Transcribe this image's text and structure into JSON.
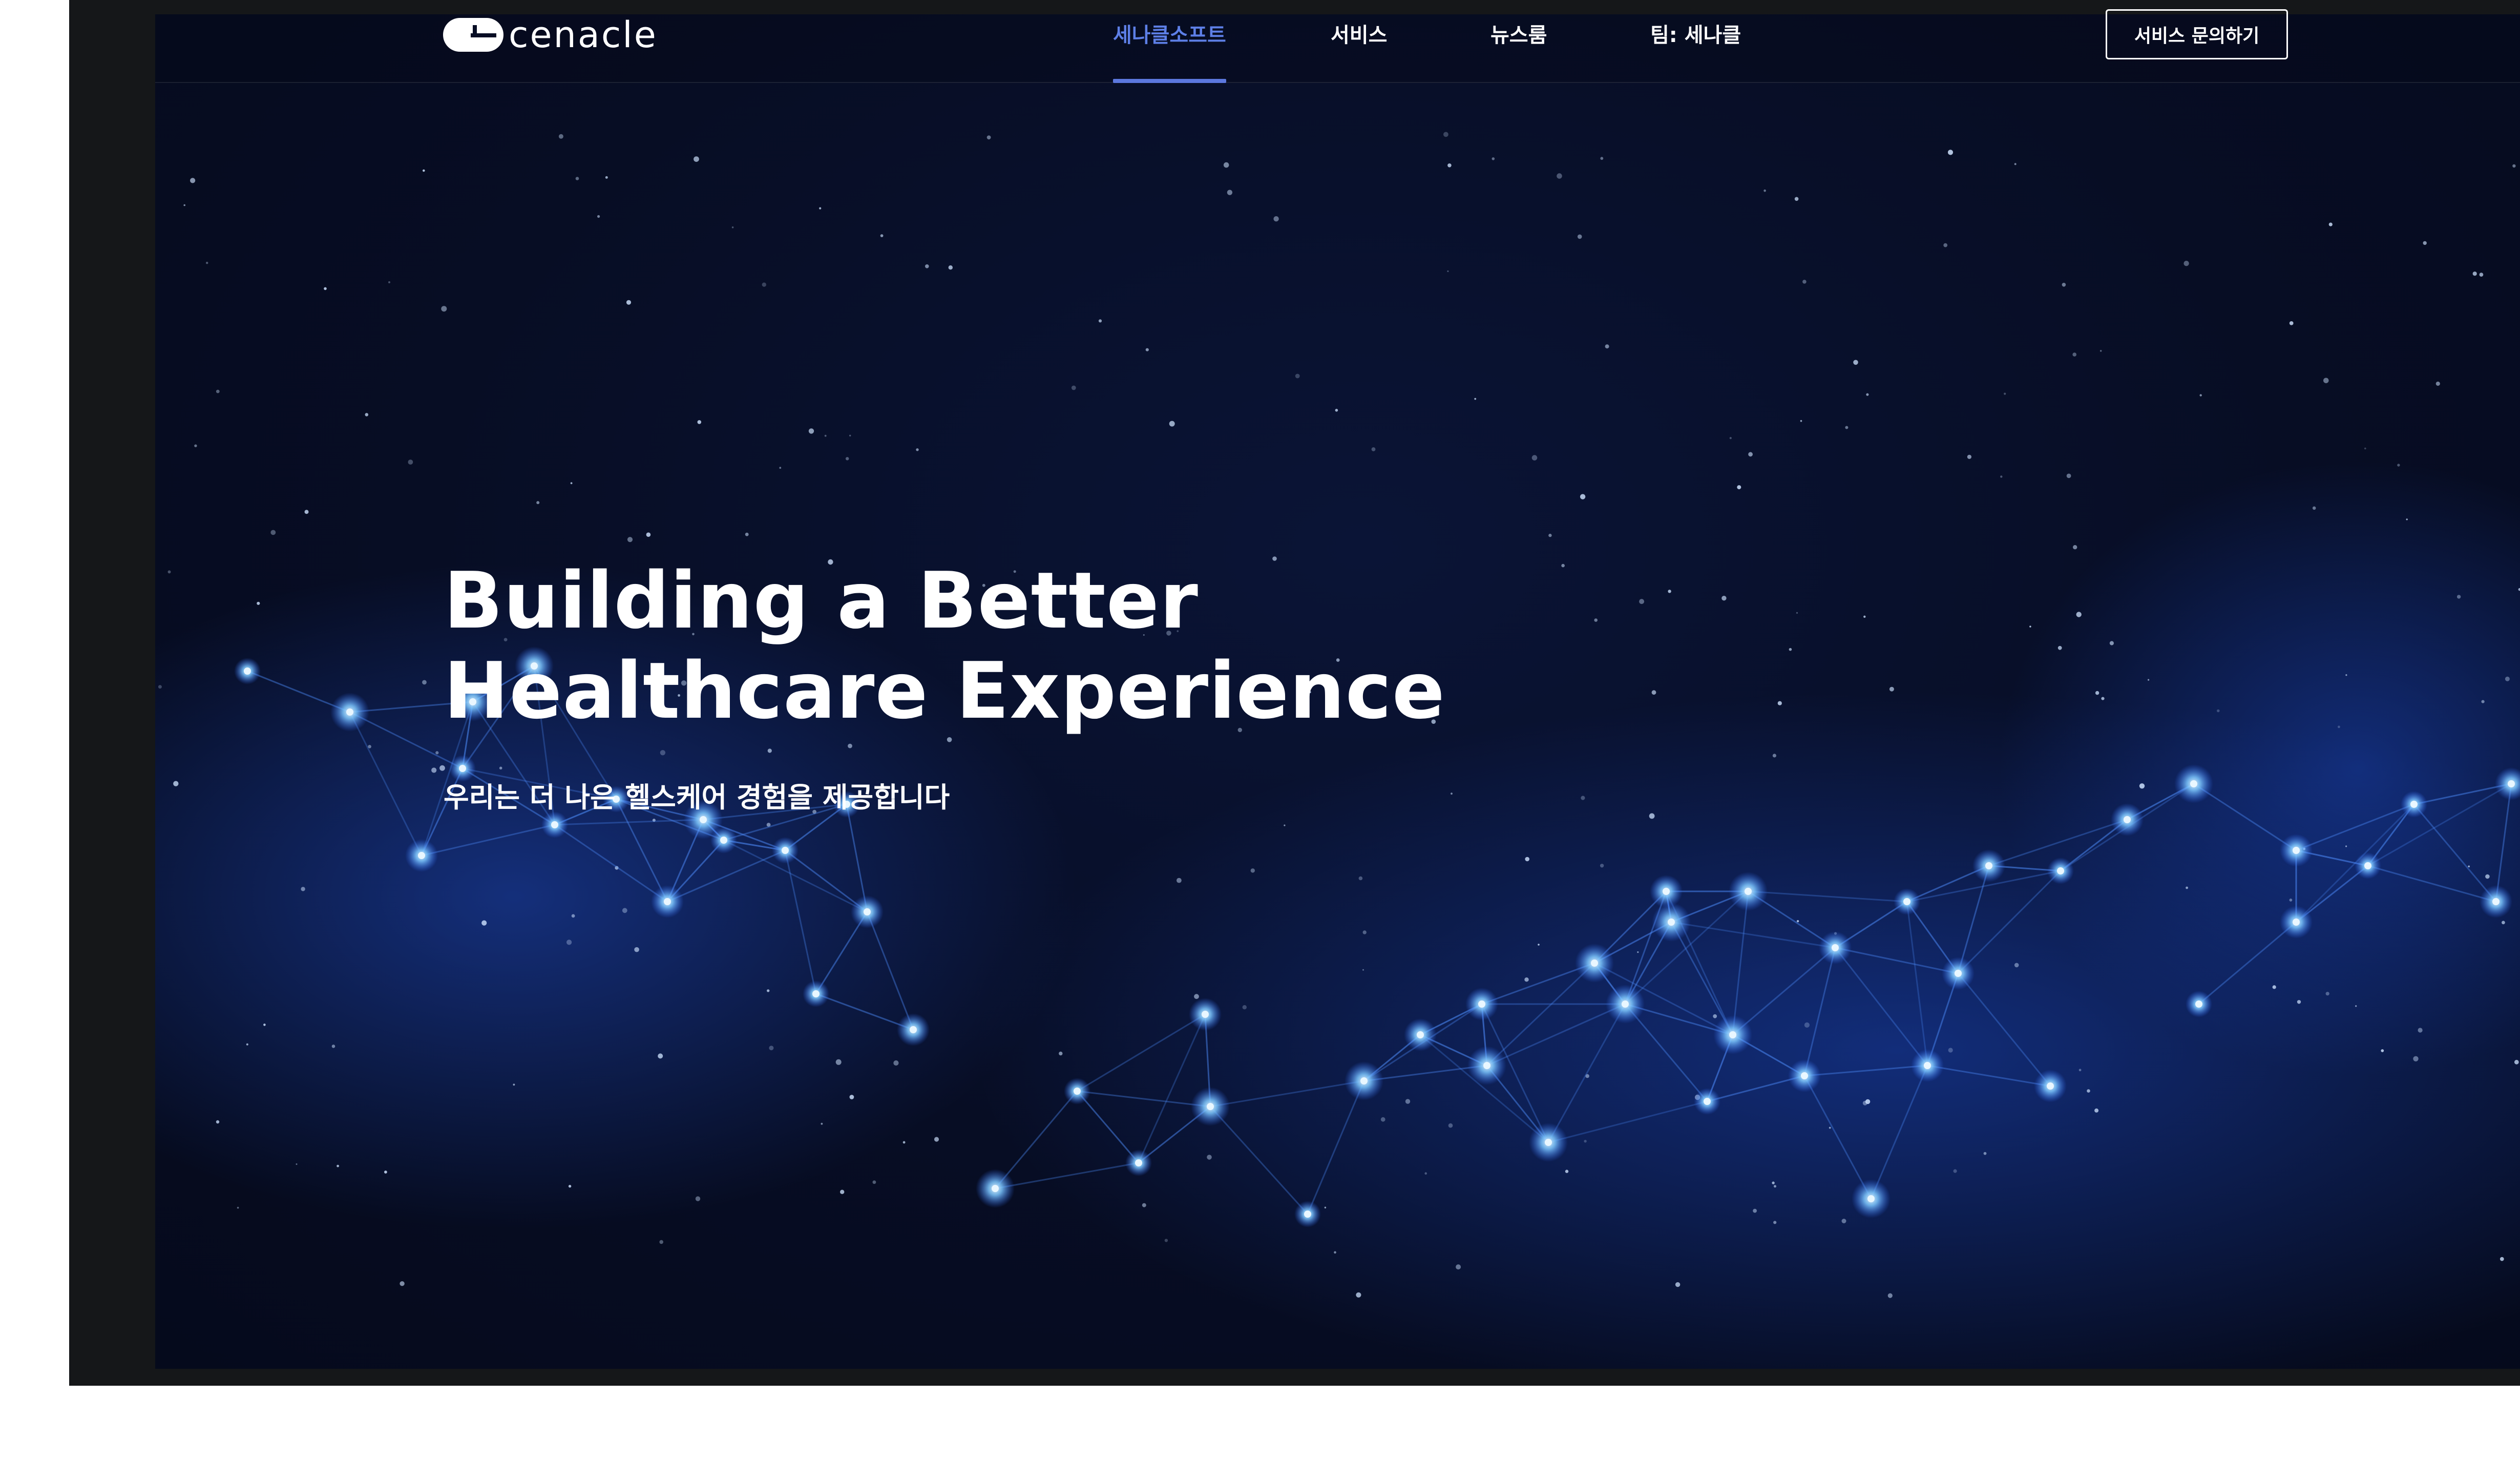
{
  "brand": {
    "logo_text": "cenacle",
    "logo_icon": "cenacle-logo-icon"
  },
  "nav": {
    "items": [
      {
        "label": "세나클소프트",
        "active": true
      },
      {
        "label": "서비스",
        "active": false
      },
      {
        "label": "뉴스룸",
        "active": false
      },
      {
        "label": "팀: 세나클",
        "active": false
      }
    ],
    "cta_label": "서비스 문의하기"
  },
  "hero": {
    "headline_line1": "Building a Better",
    "headline_line2": "Healthcare Experience",
    "subheadline": "우리는 더 나은 헬스케어 경험을 제공합니다"
  },
  "colors": {
    "background": "#070d24",
    "active_nav": "#5d7fe6",
    "accent_glow": "#6fc0ff",
    "text": "#ffffff"
  },
  "icons": [
    "cenacle-logo-icon"
  ]
}
